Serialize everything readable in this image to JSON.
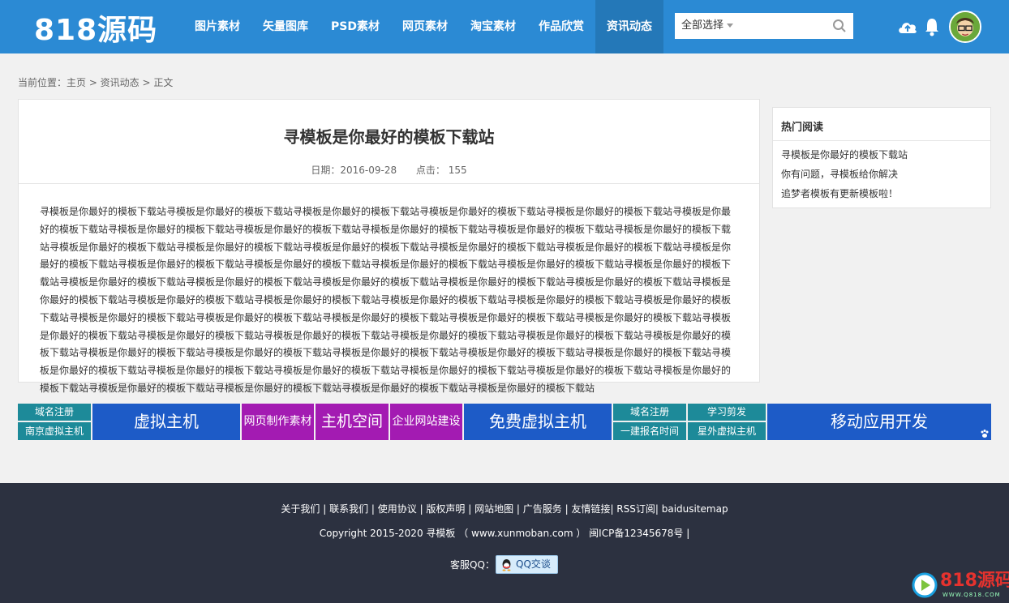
{
  "header": {
    "logo": "818源码",
    "nav": [
      {
        "label": "图片素材"
      },
      {
        "label": "矢量图库"
      },
      {
        "label": "PSD素材"
      },
      {
        "label": "网页素材"
      },
      {
        "label": "淘宝素材"
      },
      {
        "label": "作品欣赏"
      },
      {
        "label": "资讯动态",
        "active": true
      }
    ],
    "search": {
      "select_label": "全部选择",
      "icon": "search-icon"
    },
    "icons": [
      "cloud-upload-icon",
      "bell-icon",
      "avatar"
    ]
  },
  "breadcrumb": "当前位置：主页 > 资讯动态 > 正文",
  "article": {
    "title": "寻模板是你最好的模板下载站",
    "date": "日期：2016-09-28",
    "clicks": "点击： 155",
    "body": "寻模板是你最好的模板下载站寻模板是你最好的模板下载站寻模板是你最好的模板下载站寻模板是你最好的模板下载站寻模板是你最好的模板下载站寻模板是你最好的模板下载站寻模板是你最好的模板下载站寻模板是你最好的模板下载站寻模板是你最好的模板下载站寻模板是你最好的模板下载站寻模板是你最好的模板下载站寻模板是你最好的模板下载站寻模板是你最好的模板下载站寻模板是你最好的模板下载站寻模板是你最好的模板下载站寻模板是你最好的模板下载站寻模板是你最好的模板下载站寻模板是你最好的模板下载站寻模板是你最好的模板下载站寻模板是你最好的模板下载站寻模板是你最好的模板下载站寻模板是你最好的模板下载站寻模板是你最好的模板下载站寻模板是你最好的模板下载站寻模板是你最好的模板下载站寻模板是你最好的模板下载站寻模板是你最好的模板下载站寻模板是你最好的模板下载站寻模板是你最好的模板下载站寻模板是你最好的模板下载站寻模板是你最好的模板下载站寻模板是你最好的模板下载站寻模板是你最好的模板下载站寻模板是你最好的模板下载站寻模板是你最好的模板下载站寻模板是你最好的模板下载站寻模板是你最好的模板下载站寻模板是你最好的模板下载站寻模板是你最好的模板下载站寻模板是你最好的模板下载站寻模板是你最好的模板下载站寻模板是你最好的模板下载站寻模板是你最好的模板下载站寻模板是你最好的模板下载站寻模板是你最好的模板下载站寻模板是你最好的模板下载站寻模板是你最好的模板下载站寻模板是你最好的模板下载站寻模板是你最好的模板下载站寻模板是你最好的模板下载站寻模板是你最好的模板下载站寻模板是你最好的模板下载站寻模板是你最好的模板下载站寻模板是你最好的模板下载站寻模板是你最好的模板下载站寻模板是你最好的模板下载站寻模板是你最好的模板下载站寻模板是你最好的模板下载站寻模板是你最好的模板下载站"
  },
  "sidebar": {
    "title": "热门阅读",
    "items": [
      "寻模板是你最好的模板下载站",
      "你有问题，寻模板给你解决",
      "追梦者模板有更新模板啦！"
    ]
  },
  "ads": {
    "a1_top": "域名注册",
    "a1_bottom": "南京虚拟主机",
    "a2": "虚拟主机",
    "a3": "网页制作素材",
    "a4": "主机空间",
    "a5": "企业网站建设",
    "a6": "免费虚拟主机",
    "a7_top": "域名注册",
    "a7_bottom": "一建报名时间",
    "a8_top": "学习剪发",
    "a8_bottom": "星外虚拟主机",
    "a9": "移动应用开发"
  },
  "footer": {
    "links": "关于我们 | 联系我们 | 使用协议 | 版权声明 | 网站地图 | 广告服务 | 友情链接| RSS订阅| baidusitemap",
    "copyright": "Copyright 2015-2020 寻模板 （ www.xunmoban.com ） 闽ICP备12345678号 |",
    "qq_label": "客服QQ：",
    "qq_button": "QQ交谈"
  },
  "watermark": {
    "text": "818源码",
    "sub": "WWW.Q818.COM"
  }
}
